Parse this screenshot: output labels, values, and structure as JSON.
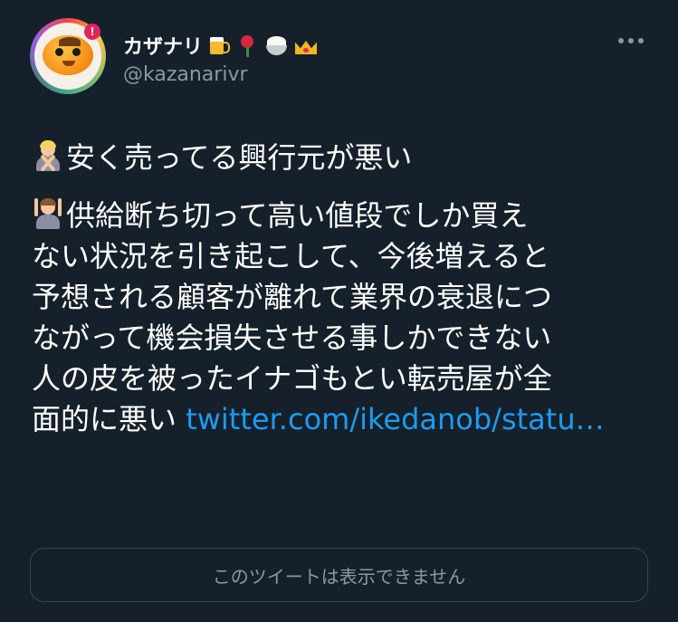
{
  "author": {
    "display_name": "カザナリ",
    "handle": "@kazanarivr",
    "name_emojis": [
      "beer-mug-icon",
      "rose-icon",
      "rice-bowl-icon",
      "crown-icon"
    ],
    "notification_badge": "!"
  },
  "tweet": {
    "paragraph1": {
      "emoji": "person-gesturing-no-icon",
      "text": "安く売ってる興行元が悪い"
    },
    "paragraph2": {
      "emoji": "person-gesturing-ok-icon",
      "lines": [
        "供給断ち切って高い値段でしか買え",
        "ない状況を引き起こして、今後増えると",
        "予想される顧客が離れて業界の衰退につ",
        "ながって機会損失させる事しかできない",
        "人の皮を被ったイナゴもとい転売屋が全"
      ],
      "last_line_text": "面的に悪い ",
      "link_text": "twitter.com/ikedanob/statu…"
    }
  },
  "quoted": {
    "unavailable_text": "このツイートは表示できません"
  },
  "colors": {
    "background": "#15202b",
    "link": "#1d9bf0",
    "secondary": "#8899a6",
    "border": "#38444d"
  }
}
